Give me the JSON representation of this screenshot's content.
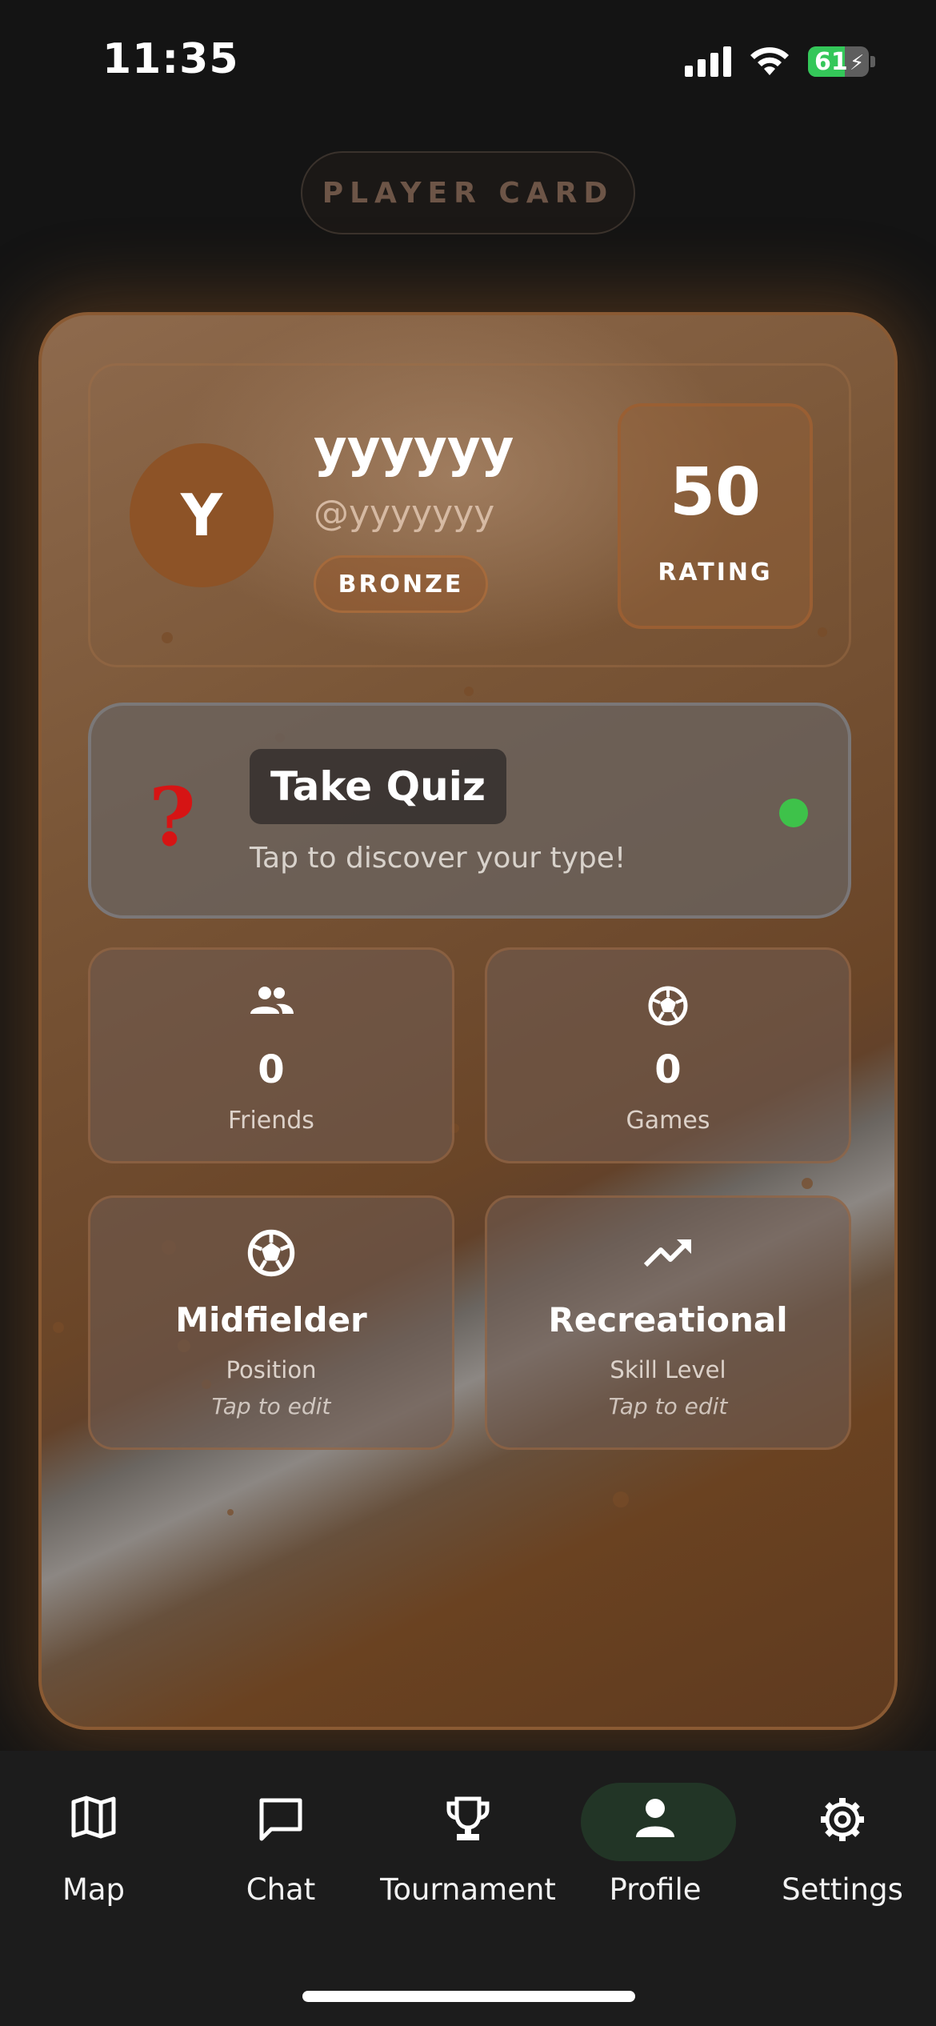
{
  "status_bar": {
    "time": "11:35",
    "battery": "61"
  },
  "header": {
    "title": "PLAYER CARD"
  },
  "profile": {
    "avatar_initial": "Y",
    "display_name": "yyyyyy",
    "handle": "@yyyyyyy",
    "rank": "BRONZE",
    "rating_value": "50",
    "rating_label": "RATING"
  },
  "quiz": {
    "icon": "question-mark-icon",
    "title": "Take Quiz",
    "subtitle": "Tap to discover your type!",
    "status_color": "#3ec24a"
  },
  "stats": [
    {
      "icon": "friends-icon",
      "value": "0",
      "label": "Friends"
    },
    {
      "icon": "soccer-ball-icon",
      "value": "0",
      "label": "Games"
    }
  ],
  "attributes": [
    {
      "icon": "soccer-ball-icon",
      "value": "Midfielder",
      "label": "Position",
      "hint": "Tap to edit"
    },
    {
      "icon": "trending-up-icon",
      "value": "Recreational",
      "label": "Skill Level",
      "hint": "Tap to edit"
    }
  ],
  "tabs": [
    {
      "icon": "map-icon",
      "label": "Map",
      "active": false
    },
    {
      "icon": "chat-icon",
      "label": "Chat",
      "active": false
    },
    {
      "icon": "trophy-icon",
      "label": "Tournament",
      "active": false
    },
    {
      "icon": "profile-icon",
      "label": "Profile",
      "active": true
    },
    {
      "icon": "settings-gear-icon",
      "label": "Settings",
      "active": false
    }
  ],
  "colors": {
    "accent_card": "#8a5a33",
    "active_tab_bg": "#223526",
    "quiz_icon": "#d61414"
  }
}
